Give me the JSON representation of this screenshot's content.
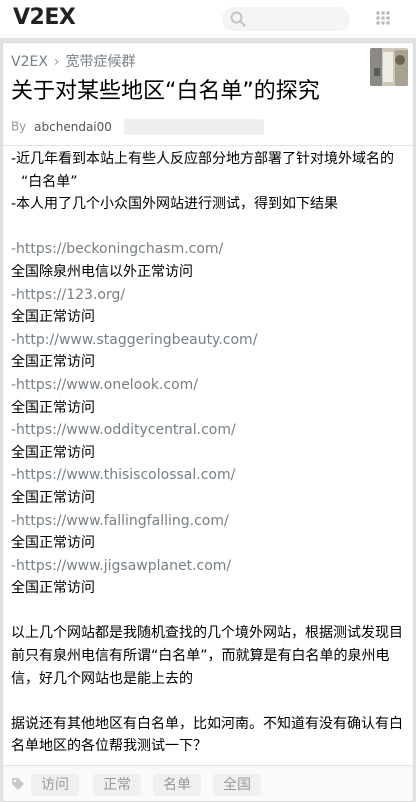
{
  "header": {
    "logo": "V2EX",
    "search_placeholder": ""
  },
  "breadcrumb": {
    "home": "V2EX",
    "separator": "›",
    "node": "宽带症候群"
  },
  "topic": {
    "title": "关于对某些地区“白名单”的探究",
    "by_label": "By",
    "author": "abchendai00"
  },
  "content": {
    "lines": [
      "-近几年看到本站上有些人反应部分地方部署了针对境外域名的",
      "“白名单”",
      "-本人用了几个小众国外网站进行测试，得到如下结果",
      "",
      "-https://beckoningchasm.com/",
      "全国除泉州电信以外正常访问",
      "-https://123.org/",
      "全国正常访问",
      "-http://www.staggeringbeauty.com/",
      "全国正常访问",
      "-https://www.onelook.com/",
      "全国正常访问",
      "-https://www.odditycentral.com/",
      "全国正常访问",
      "-https://www.thisiscolossal.com/",
      "全国正常访问",
      "-https://www.fallingfalling.com/",
      "全国正常访问",
      "-https://www.jigsawplanet.com/",
      "全国正常访问",
      "",
      "以上几个网站都是我随机查找的几个境外网站，根据测试发现目",
      "前只有泉州电信有所谓“白名单”，而就算是有白名单的泉州电",
      "信，好几个网站也是能上去的",
      "",
      "据说还有其他地区有白名单，比如河南。不知道有没有确认有白",
      "名单地区的各位帮我测试一下？"
    ]
  },
  "tags": [
    "访问",
    "正常",
    "名单",
    "全国"
  ],
  "colors": {
    "link": "#778087",
    "muted": "#999999",
    "page_bg": "#e2e2e2"
  }
}
